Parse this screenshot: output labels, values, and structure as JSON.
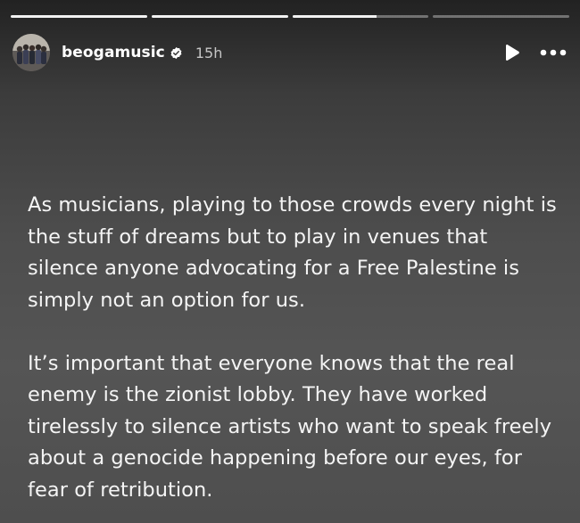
{
  "progress": {
    "segments": [
      1.0,
      1.0,
      0.62,
      0.0
    ]
  },
  "header": {
    "username": "beogamusic",
    "verified": true,
    "time": "15h",
    "avatar_icon": "group-photo-avatar",
    "play_icon": "play-icon",
    "more_icon": "more-options-icon"
  },
  "story": {
    "paragraph1": "As musicians, playing to those crowds every night is the stuff of dreams but to play in venues that silence anyone advocating for a Free Palestine is simply not an option for us.",
    "paragraph2": "It’s important that everyone knows that the real enemy is the zionist lobby. They have worked tirelessly to silence artists who want to speak freely about a genocide happening before our eyes, for fear of retribution."
  },
  "colors": {
    "background_top": "#222222",
    "background_mid": "#555555",
    "text": "#f4f4f4",
    "time_text": "#c6c6c6"
  }
}
